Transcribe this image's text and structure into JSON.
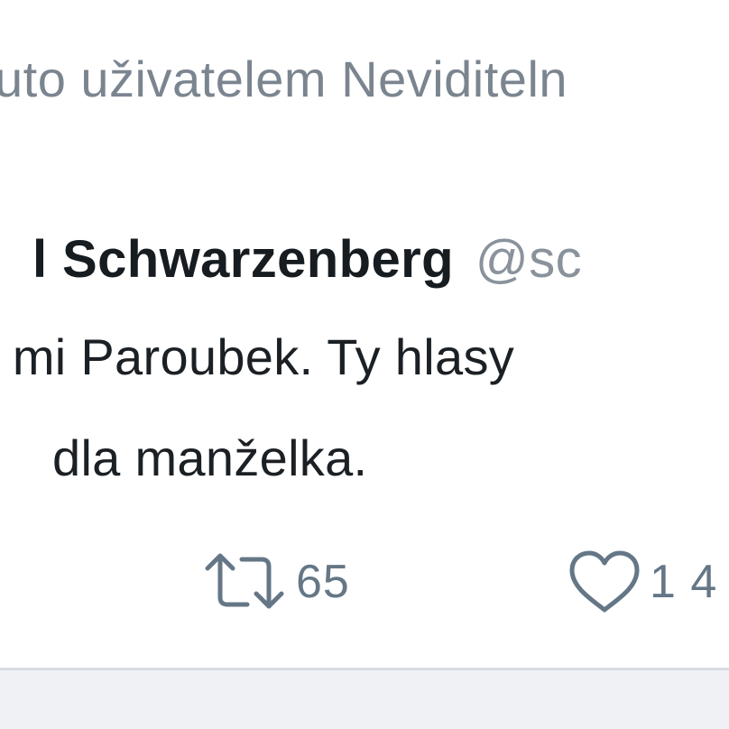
{
  "tweet": {
    "context_text": "uto uživatelem Neviditeln",
    "author": {
      "name": "l Schwarzenberg",
      "handle": "@sc"
    },
    "text_lines": [
      " mi Paroubek. Ty hlasy",
      "dla manželka."
    ],
    "actions": {
      "retweet": {
        "icon": "retweet-icon",
        "count": "65"
      },
      "like": {
        "icon": "heart-icon",
        "count": "1 4"
      }
    }
  },
  "colors": {
    "muted_text": "#7b8590",
    "primary_text": "#171c21",
    "icon": "#657786",
    "divider": "#d8dde2",
    "background_below": "#eff1f4"
  }
}
